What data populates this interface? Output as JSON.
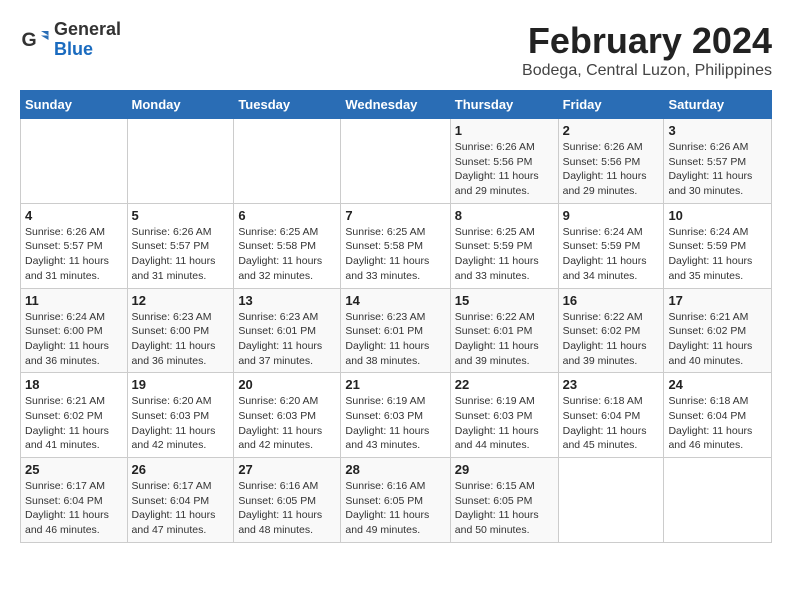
{
  "logo": {
    "general": "General",
    "blue": "Blue"
  },
  "header": {
    "month_year": "February 2024",
    "location": "Bodega, Central Luzon, Philippines"
  },
  "weekdays": [
    "Sunday",
    "Monday",
    "Tuesday",
    "Wednesday",
    "Thursday",
    "Friday",
    "Saturday"
  ],
  "weeks": [
    [
      {
        "day": "",
        "info": ""
      },
      {
        "day": "",
        "info": ""
      },
      {
        "day": "",
        "info": ""
      },
      {
        "day": "",
        "info": ""
      },
      {
        "day": "1",
        "info": "Sunrise: 6:26 AM\nSunset: 5:56 PM\nDaylight: 11 hours and 29 minutes."
      },
      {
        "day": "2",
        "info": "Sunrise: 6:26 AM\nSunset: 5:56 PM\nDaylight: 11 hours and 29 minutes."
      },
      {
        "day": "3",
        "info": "Sunrise: 6:26 AM\nSunset: 5:57 PM\nDaylight: 11 hours and 30 minutes."
      }
    ],
    [
      {
        "day": "4",
        "info": "Sunrise: 6:26 AM\nSunset: 5:57 PM\nDaylight: 11 hours and 31 minutes."
      },
      {
        "day": "5",
        "info": "Sunrise: 6:26 AM\nSunset: 5:57 PM\nDaylight: 11 hours and 31 minutes."
      },
      {
        "day": "6",
        "info": "Sunrise: 6:25 AM\nSunset: 5:58 PM\nDaylight: 11 hours and 32 minutes."
      },
      {
        "day": "7",
        "info": "Sunrise: 6:25 AM\nSunset: 5:58 PM\nDaylight: 11 hours and 33 minutes."
      },
      {
        "day": "8",
        "info": "Sunrise: 6:25 AM\nSunset: 5:59 PM\nDaylight: 11 hours and 33 minutes."
      },
      {
        "day": "9",
        "info": "Sunrise: 6:24 AM\nSunset: 5:59 PM\nDaylight: 11 hours and 34 minutes."
      },
      {
        "day": "10",
        "info": "Sunrise: 6:24 AM\nSunset: 5:59 PM\nDaylight: 11 hours and 35 minutes."
      }
    ],
    [
      {
        "day": "11",
        "info": "Sunrise: 6:24 AM\nSunset: 6:00 PM\nDaylight: 11 hours and 36 minutes."
      },
      {
        "day": "12",
        "info": "Sunrise: 6:23 AM\nSunset: 6:00 PM\nDaylight: 11 hours and 36 minutes."
      },
      {
        "day": "13",
        "info": "Sunrise: 6:23 AM\nSunset: 6:01 PM\nDaylight: 11 hours and 37 minutes."
      },
      {
        "day": "14",
        "info": "Sunrise: 6:23 AM\nSunset: 6:01 PM\nDaylight: 11 hours and 38 minutes."
      },
      {
        "day": "15",
        "info": "Sunrise: 6:22 AM\nSunset: 6:01 PM\nDaylight: 11 hours and 39 minutes."
      },
      {
        "day": "16",
        "info": "Sunrise: 6:22 AM\nSunset: 6:02 PM\nDaylight: 11 hours and 39 minutes."
      },
      {
        "day": "17",
        "info": "Sunrise: 6:21 AM\nSunset: 6:02 PM\nDaylight: 11 hours and 40 minutes."
      }
    ],
    [
      {
        "day": "18",
        "info": "Sunrise: 6:21 AM\nSunset: 6:02 PM\nDaylight: 11 hours and 41 minutes."
      },
      {
        "day": "19",
        "info": "Sunrise: 6:20 AM\nSunset: 6:03 PM\nDaylight: 11 hours and 42 minutes."
      },
      {
        "day": "20",
        "info": "Sunrise: 6:20 AM\nSunset: 6:03 PM\nDaylight: 11 hours and 42 minutes."
      },
      {
        "day": "21",
        "info": "Sunrise: 6:19 AM\nSunset: 6:03 PM\nDaylight: 11 hours and 43 minutes."
      },
      {
        "day": "22",
        "info": "Sunrise: 6:19 AM\nSunset: 6:03 PM\nDaylight: 11 hours and 44 minutes."
      },
      {
        "day": "23",
        "info": "Sunrise: 6:18 AM\nSunset: 6:04 PM\nDaylight: 11 hours and 45 minutes."
      },
      {
        "day": "24",
        "info": "Sunrise: 6:18 AM\nSunset: 6:04 PM\nDaylight: 11 hours and 46 minutes."
      }
    ],
    [
      {
        "day": "25",
        "info": "Sunrise: 6:17 AM\nSunset: 6:04 PM\nDaylight: 11 hours and 46 minutes."
      },
      {
        "day": "26",
        "info": "Sunrise: 6:17 AM\nSunset: 6:04 PM\nDaylight: 11 hours and 47 minutes."
      },
      {
        "day": "27",
        "info": "Sunrise: 6:16 AM\nSunset: 6:05 PM\nDaylight: 11 hours and 48 minutes."
      },
      {
        "day": "28",
        "info": "Sunrise: 6:16 AM\nSunset: 6:05 PM\nDaylight: 11 hours and 49 minutes."
      },
      {
        "day": "29",
        "info": "Sunrise: 6:15 AM\nSunset: 6:05 PM\nDaylight: 11 hours and 50 minutes."
      },
      {
        "day": "",
        "info": ""
      },
      {
        "day": "",
        "info": ""
      }
    ]
  ]
}
